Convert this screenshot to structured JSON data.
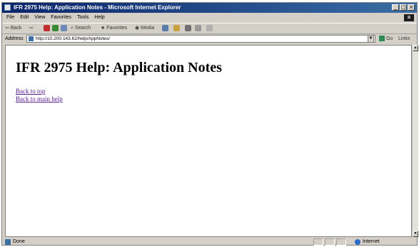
{
  "window": {
    "title": "IFR 2975 Help: Application Notes - Microsoft Internet Explorer",
    "controls": [
      "_",
      "□",
      "×"
    ]
  },
  "menubar": {
    "items": [
      "File",
      "Edit",
      "View",
      "Favorites",
      "Tools",
      "Help"
    ]
  },
  "toolbar": {
    "back_label": "Back",
    "search_label": "Search",
    "favorites_label": "Favorites",
    "media_label": "Media"
  },
  "addressbar": {
    "label": "Address",
    "url": "http://10.200.143.62/help/AppNotes/",
    "go_label": "Go",
    "links_label": "Links"
  },
  "page": {
    "title": "IFR 2975 Help: Application Notes",
    "links": [
      "Back to top",
      "Back to main help"
    ]
  },
  "statusbar": {
    "status": "Done",
    "zone": "Internet"
  },
  "colors": {
    "titlebar_start": "#0a246a",
    "titlebar_end": "#3a6ea5",
    "chrome": "#d4d0c8",
    "visited_link": "#551a8b"
  }
}
